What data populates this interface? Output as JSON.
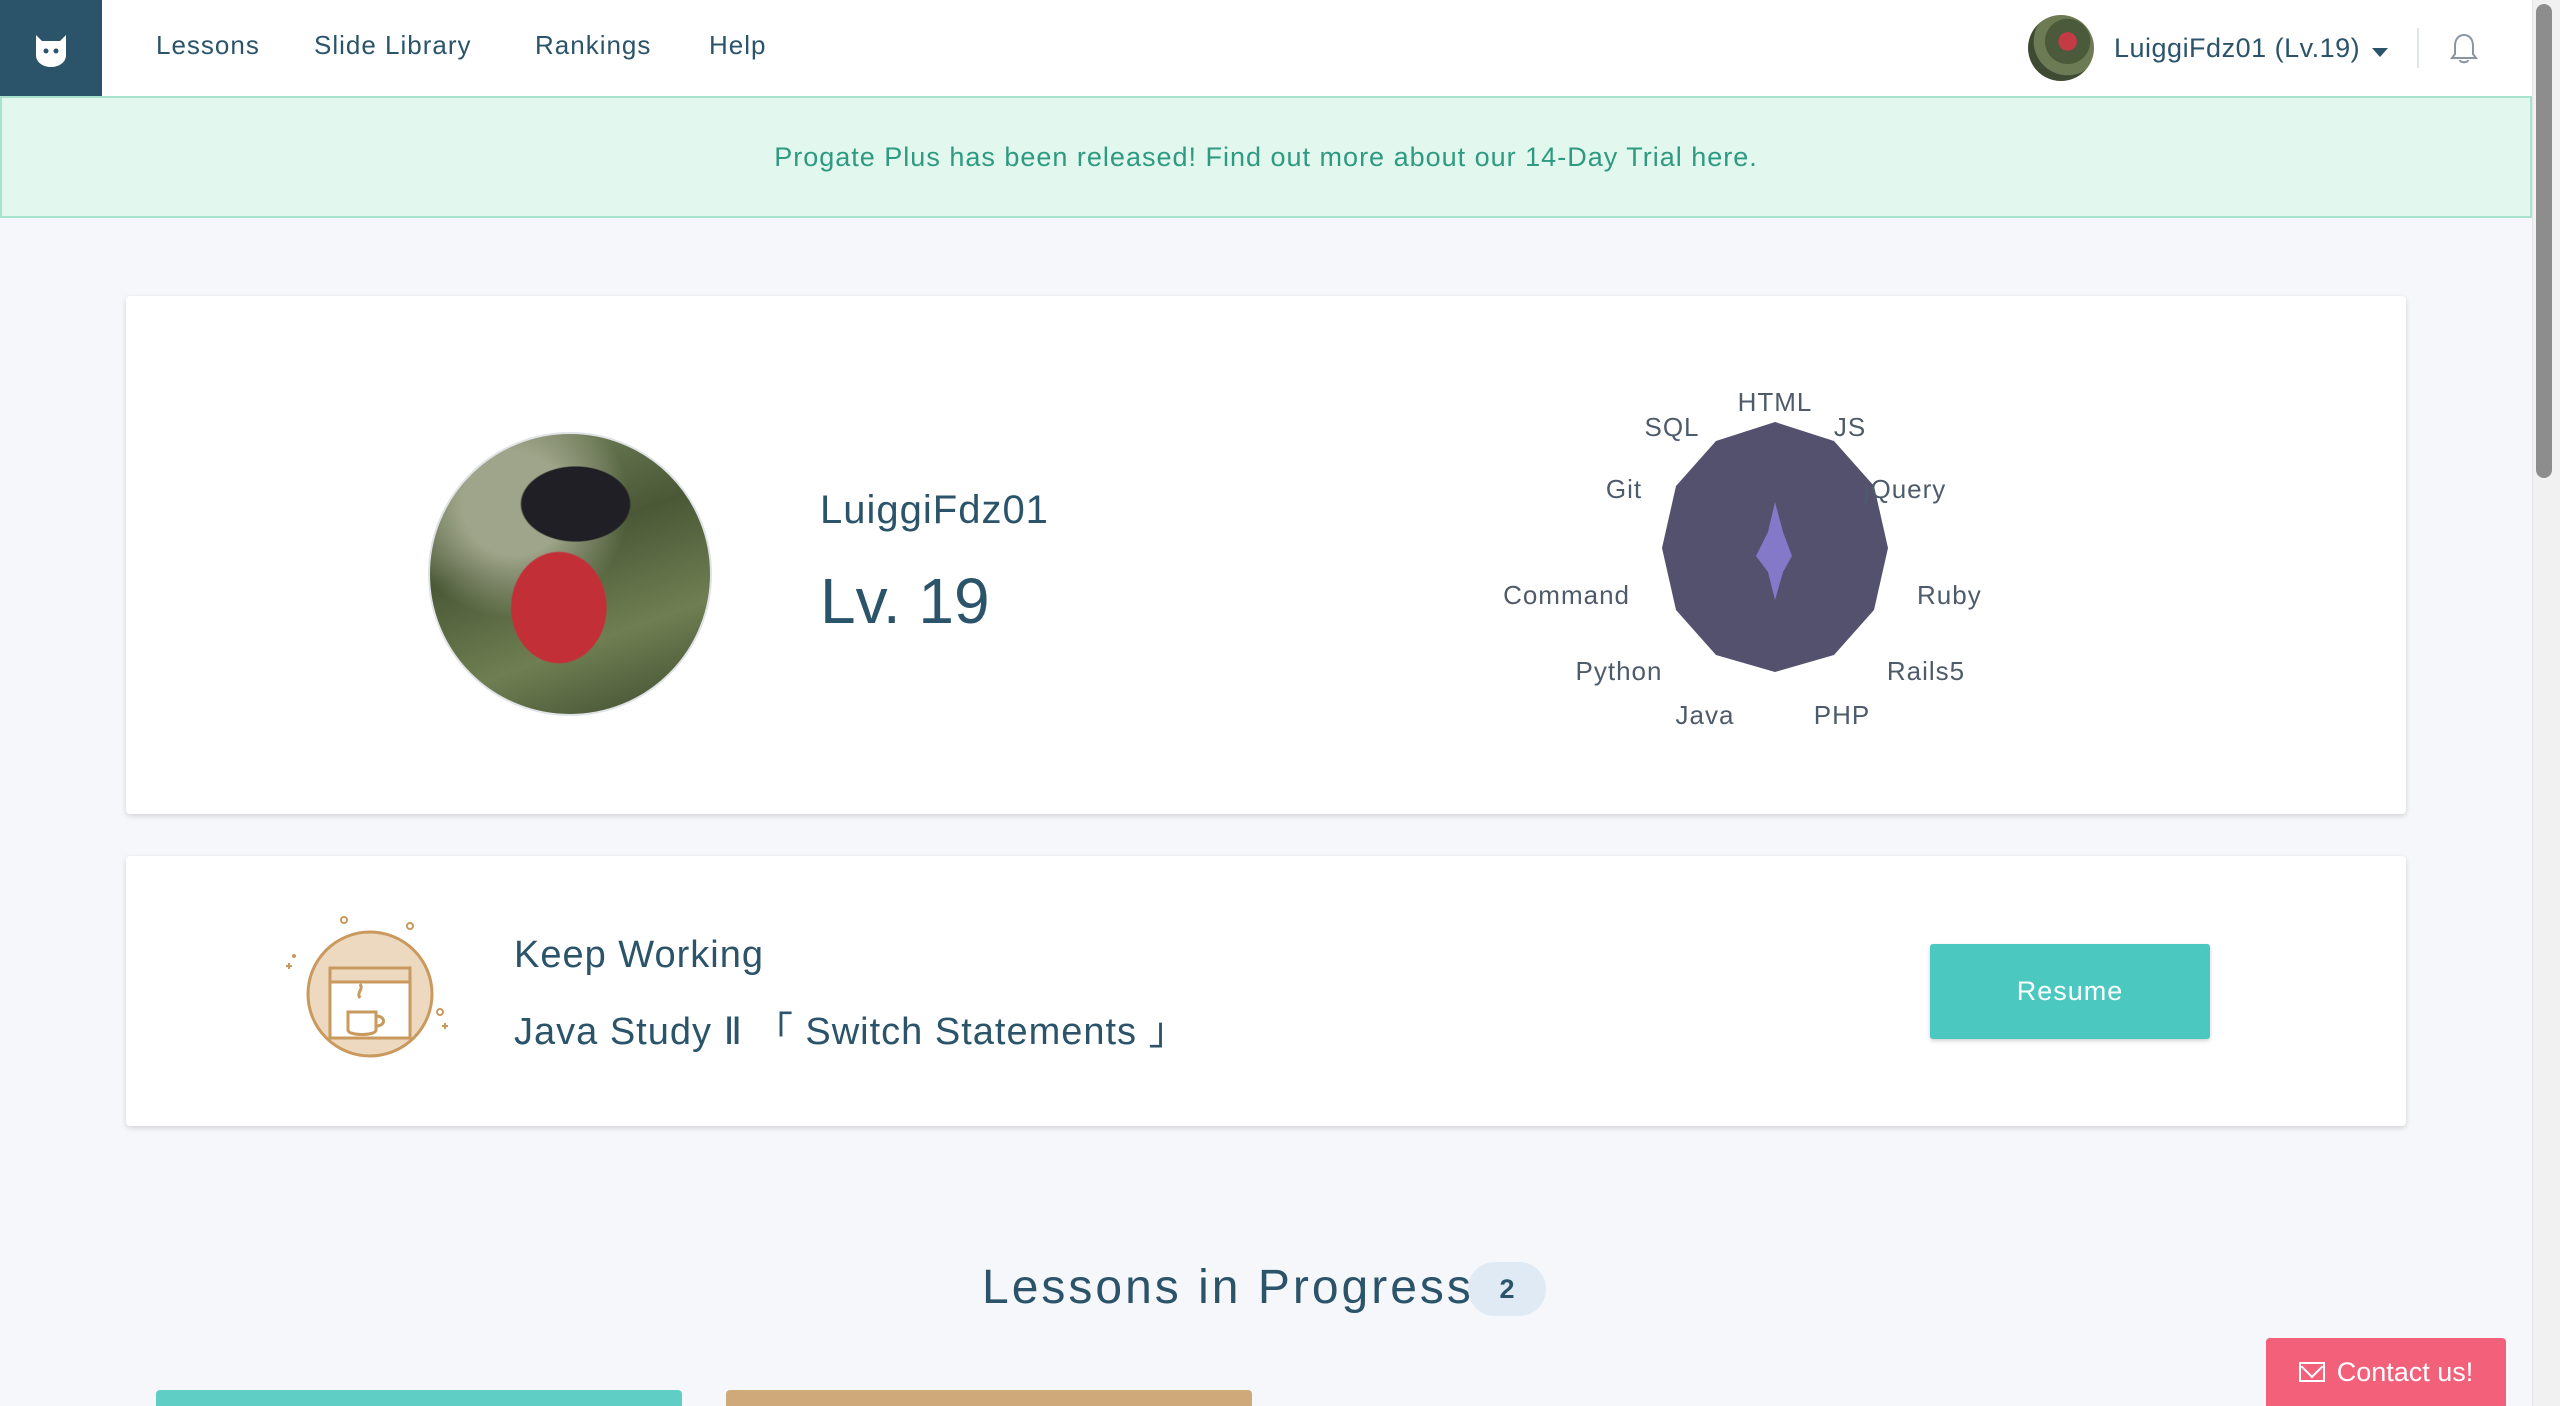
{
  "nav": {
    "items": [
      {
        "label": "Lessons"
      },
      {
        "label": "Slide Library"
      },
      {
        "label": "Rankings"
      },
      {
        "label": "Help"
      }
    ],
    "user_label": "LuiggiFdz01 (Lv.19)"
  },
  "banner": {
    "text": "Progate Plus has been released! Find out more about our 14-Day Trial here."
  },
  "profile": {
    "username": "LuiggiFdz01",
    "level": "Lv. 19",
    "skills_chart": {
      "labels": [
        "HTML",
        "JS",
        "jQuery",
        "Ruby",
        "Rails5",
        "PHP",
        "Java",
        "Python",
        "Command",
        "Git",
        "SQL"
      ]
    }
  },
  "keep_working": {
    "title": "Keep Working",
    "lesson": "Java Study Ⅱ 「 Switch Statements 」",
    "resume_label": "Resume"
  },
  "lessons_in_progress": {
    "title": "Lessons in Progress",
    "count": "2"
  },
  "contact": {
    "label": "Contact us!"
  },
  "colors": {
    "brand": "#2b546a",
    "accent": "#4bc8c0",
    "banner_bg": "#e2f7ee",
    "contact": "#f2607a",
    "radar_fill": "#54516f",
    "radar_skill": "#8479c9"
  }
}
